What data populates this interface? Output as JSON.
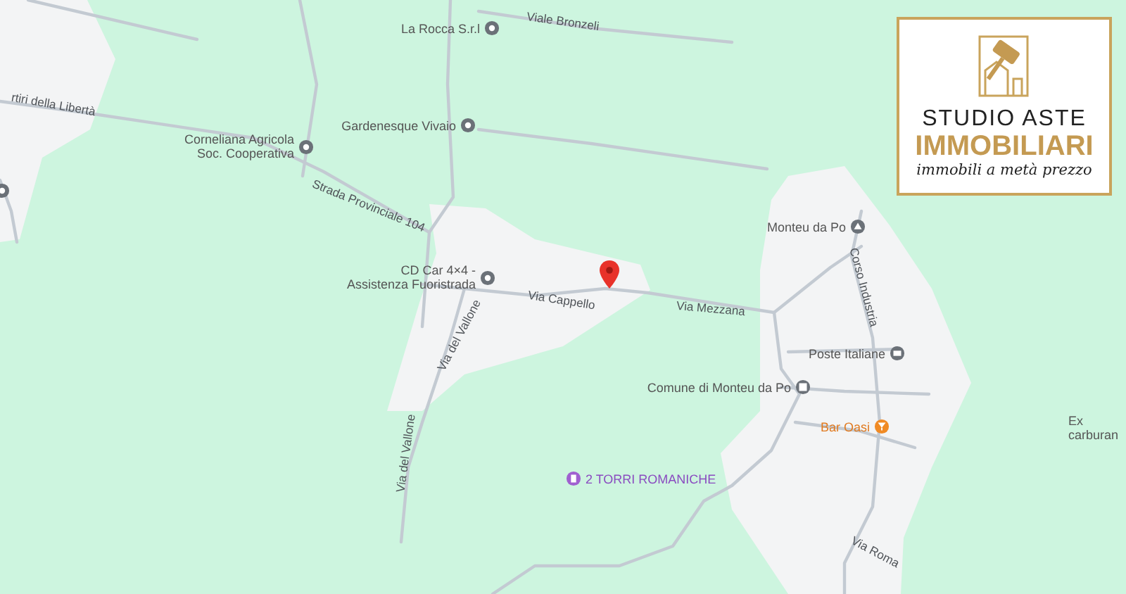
{
  "map": {
    "places": [
      {
        "name": "La Rocca S.r.l",
        "kind": "shop"
      },
      {
        "name": "Gardenesque Vivaio",
        "kind": "shop"
      },
      {
        "name": "Corneliana Agricola\nSoc. Cooperativa",
        "kind": "shop"
      },
      {
        "name": "CD Car 4×4 -\nAssistenza Fuoristrada",
        "kind": "shop"
      },
      {
        "name": "Monteu da Po",
        "kind": "town"
      },
      {
        "name": "Poste Italiane",
        "kind": "post"
      },
      {
        "name": "Comune di Monteu da Po",
        "kind": "civic"
      },
      {
        "name": "Bar Oasi",
        "kind": "bar"
      },
      {
        "name": "2 TORRI ROMANICHE",
        "kind": "landmark"
      },
      {
        "name": "Ex\ncarburan",
        "kind": "plain"
      }
    ],
    "streets": [
      {
        "name": "Viale Bronzeli"
      },
      {
        "name": "rtiri della Libertà"
      },
      {
        "name": "Strada Provinciale 104"
      },
      {
        "name": "Via Cappello"
      },
      {
        "name": "Via Mezzana"
      },
      {
        "name": "Via del Vallone"
      },
      {
        "name": "Via del Vallone"
      },
      {
        "name": "Corso Industria"
      },
      {
        "name": "Via Roma"
      }
    ]
  },
  "logo": {
    "title": "STUDIO ASTE",
    "subtitle": "IMMOBILIARI",
    "tagline": "immobili a metà prezzo"
  }
}
